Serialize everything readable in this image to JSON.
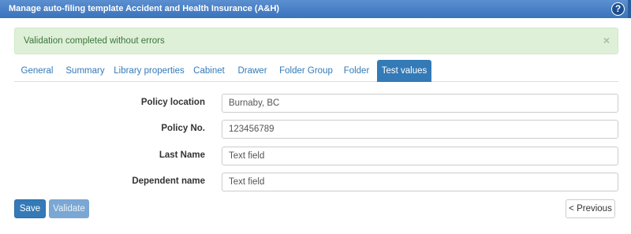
{
  "window": {
    "title": "Manage auto-filing template Accident and Health Insurance (A&H)",
    "help_glyph": "?"
  },
  "alert": {
    "message": "Validation completed without errors",
    "close_glyph": "×"
  },
  "tabs": [
    {
      "label": "General",
      "active": false
    },
    {
      "label": "Summary",
      "active": false
    },
    {
      "label": "Library properties",
      "active": false
    },
    {
      "label": "Cabinet",
      "active": false
    },
    {
      "label": "Drawer",
      "active": false
    },
    {
      "label": "Folder Group",
      "active": false
    },
    {
      "label": "Folder",
      "active": false
    },
    {
      "label": "Test values",
      "active": true
    }
  ],
  "fields": [
    {
      "label": "Policy location",
      "value": "Burnaby, BC"
    },
    {
      "label": "Policy No.",
      "value": "123456789"
    },
    {
      "label": "Last Name",
      "value": "Text field"
    },
    {
      "label": "Dependent name",
      "value": "Text field"
    }
  ],
  "buttons": {
    "save": "Save",
    "validate": "Validate",
    "previous": "< Previous"
  },
  "colors": {
    "titlebar": "#3a73bd",
    "primary": "#337ab7",
    "alert_bg": "#dff0d8",
    "alert_text": "#3c763d"
  }
}
